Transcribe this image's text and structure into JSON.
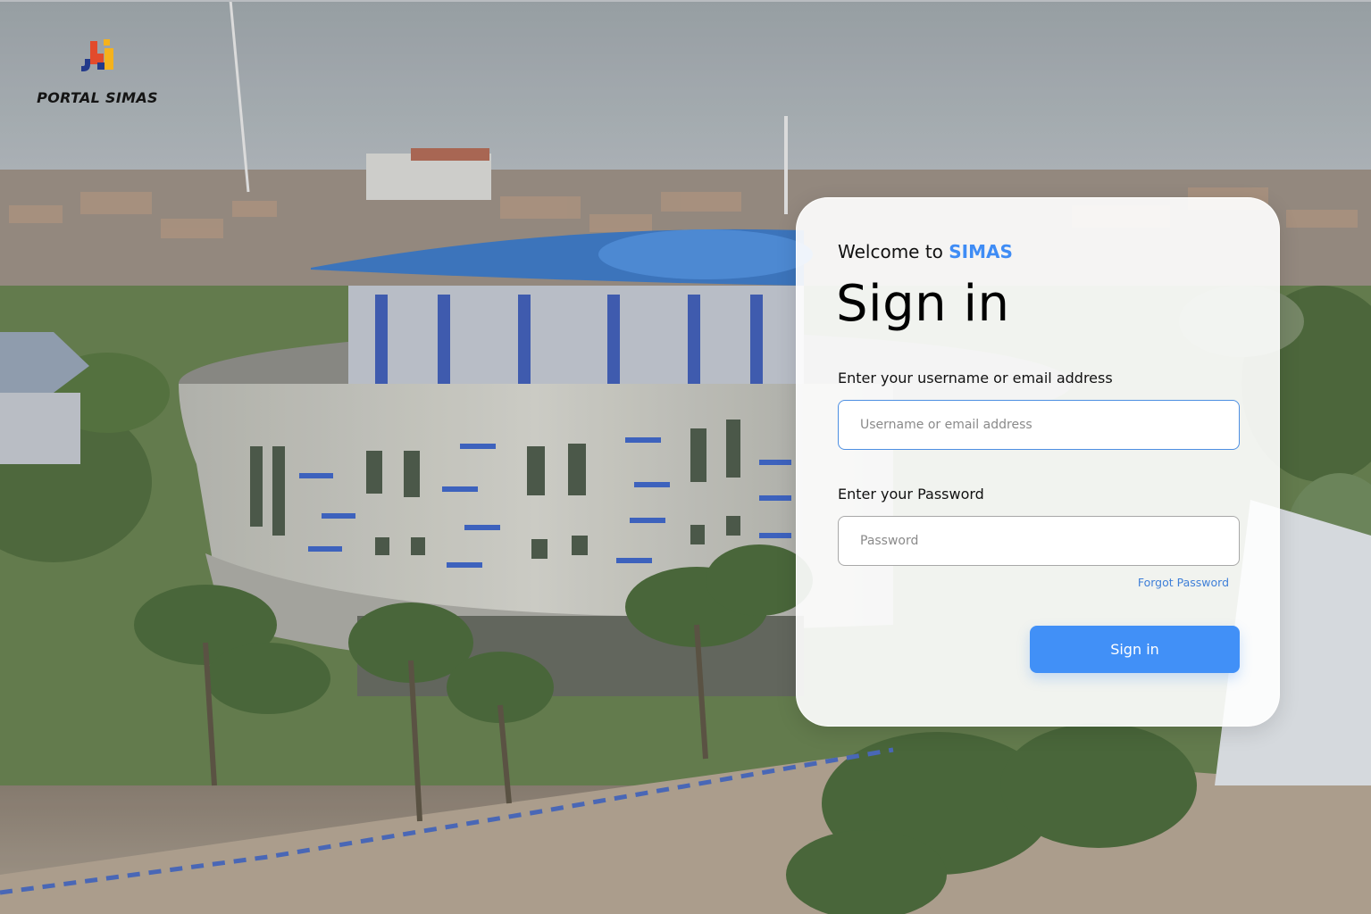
{
  "brand": {
    "name": "PORTAL SIMAS",
    "logo_icon": "portal-simas-logo",
    "logo_colors": [
      "#233a8b",
      "#e24b2c",
      "#f5b21c"
    ]
  },
  "background": {
    "description_icon": "campus-aerial-photo",
    "sky_color": "#9aa3a9",
    "foliage_color": "#4f6e3c",
    "building_color": "#b9bab3",
    "roof_color": "#2c69b6"
  },
  "login": {
    "welcome_prefix": "Welcome to ",
    "welcome_brand": "SIMAS",
    "title": "Sign in",
    "username_label": "Enter your username or email address",
    "username_placeholder": "Username or email address",
    "username_value": "",
    "password_label": "Enter your Password",
    "password_placeholder": "Password",
    "password_value": "",
    "forgot_password": "Forgot Password",
    "submit_label": "Sign in"
  },
  "colors": {
    "accent": "#4190f7",
    "link": "#3f7fd8",
    "focus_border": "#4d8fe2"
  }
}
